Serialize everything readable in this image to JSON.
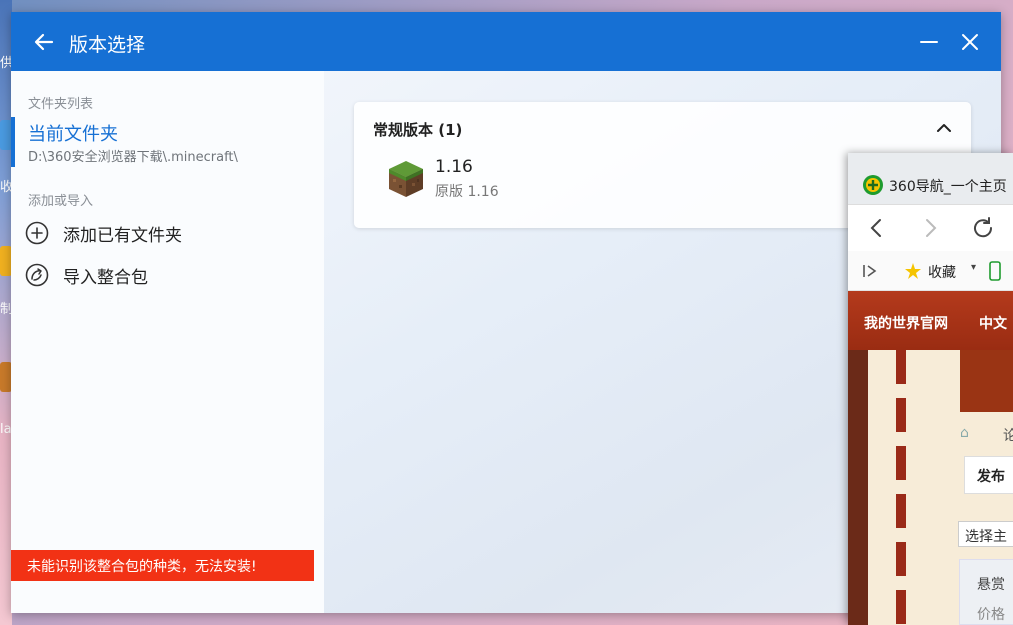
{
  "window": {
    "title": "版本选择",
    "back_icon": "arrow-left-icon",
    "minimize_icon": "minimize-icon",
    "close_icon": "close-icon"
  },
  "sidebar": {
    "folder_list_label": "文件夹列表",
    "current_folder": {
      "title": "当前文件夹",
      "path": "D:\\360安全浏览器下载\\.minecraft\\"
    },
    "add_import_label": "添加或导入",
    "items": [
      {
        "label": "添加已有文件夹",
        "icon": "add-circle-icon"
      },
      {
        "label": "导入整合包",
        "icon": "import-package-icon"
      }
    ],
    "error_message": "未能识别该整合包的种类，无法安装!"
  },
  "main": {
    "group_title": "常规版本 (1)",
    "versions": [
      {
        "name": "1.16",
        "description": "原版 1.16",
        "icon": "grass-block-icon"
      }
    ]
  },
  "browser": {
    "tab_title": "360导航_一个主页",
    "favorites_label": "收藏",
    "nav_links": [
      "我的世界官网",
      "中文"
    ],
    "page_text": [
      "论",
      "发布",
      "选择主",
      "悬赏",
      "价格"
    ]
  },
  "colors": {
    "accent": "#1670d4",
    "error": "#f23215"
  }
}
